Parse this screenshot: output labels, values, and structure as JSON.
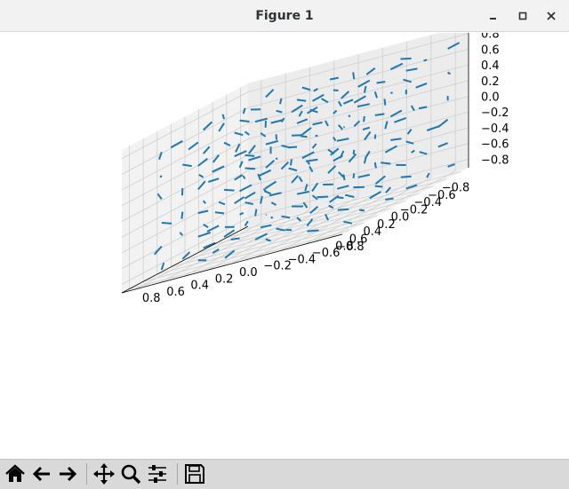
{
  "window": {
    "title": "Figure 1",
    "buttons": [
      {
        "name": "minimize",
        "icon": "minimize-icon"
      },
      {
        "name": "maximize",
        "icon": "maximize-icon"
      },
      {
        "name": "close",
        "icon": "close-icon"
      }
    ]
  },
  "toolbar": {
    "buttons": [
      {
        "name": "home",
        "icon": "home-icon"
      },
      {
        "name": "back",
        "icon": "arrow-left-icon"
      },
      {
        "name": "forward",
        "icon": "arrow-right-icon"
      },
      {
        "name": "pan",
        "icon": "move-icon"
      },
      {
        "name": "zoom",
        "icon": "magnifier-icon"
      },
      {
        "name": "configure-subplots",
        "icon": "sliders-icon"
      },
      {
        "name": "save",
        "icon": "floppy-disk-icon"
      }
    ]
  },
  "chart_data": {
    "type": "quiver3d",
    "title": "",
    "xlabel": "",
    "ylabel": "",
    "zlabel": "",
    "xlim": [
      -0.8,
      0.8
    ],
    "ylim": [
      -0.8,
      0.8
    ],
    "zlim": [
      -0.8,
      0.8
    ],
    "x_ticks": [
      "−0.8",
      "−0.6",
      "−0.4",
      "−0.2",
      "0.0",
      "0.2",
      "0.4",
      "0.6",
      "0.8"
    ],
    "y_ticks": [
      "−0.8",
      "−0.6",
      "−0.4",
      "−0.2",
      "0.0",
      "0.2",
      "0.4",
      "0.6",
      "0.8"
    ],
    "z_ticks": [
      "−0.8",
      "−0.6",
      "−0.4",
      "−0.2",
      "0.0",
      "0.2",
      "0.4",
      "0.6",
      "0.8"
    ],
    "grid": true,
    "arrow_color": "#1f77b4",
    "grid_points_per_axis": 6,
    "grid_start": -0.8,
    "grid_step": 0.3
  }
}
